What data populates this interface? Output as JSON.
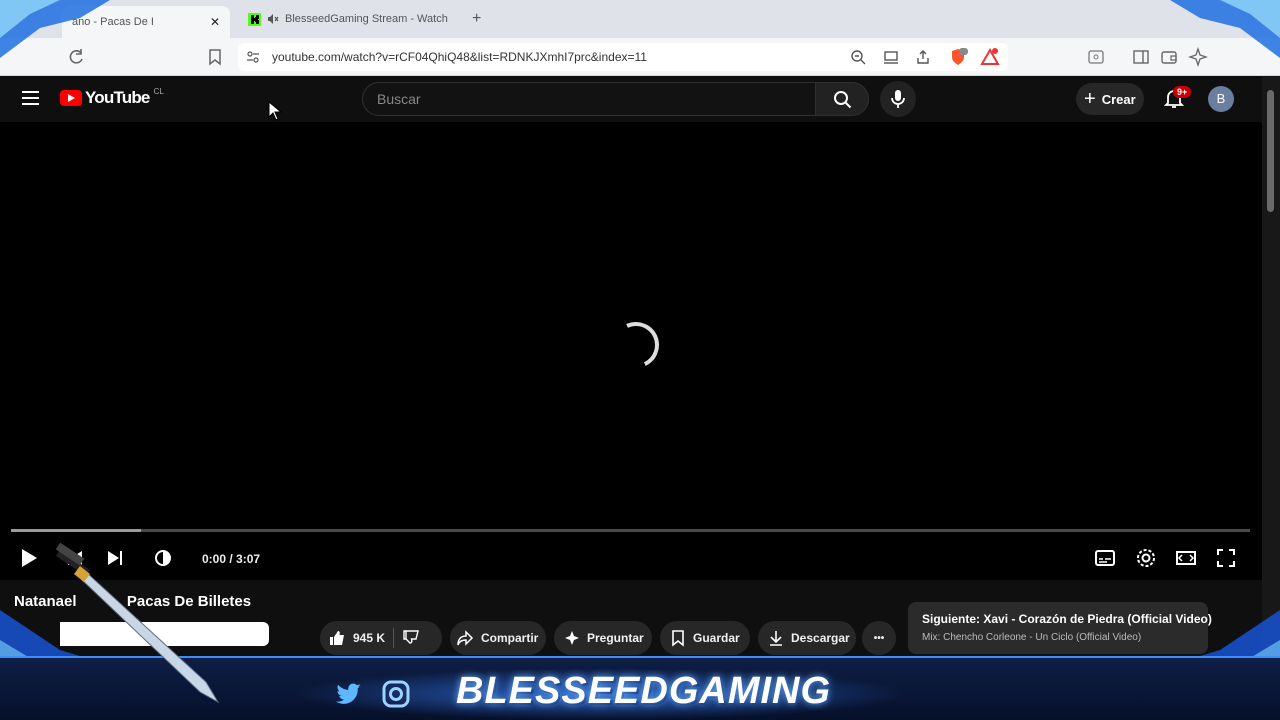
{
  "browser": {
    "tabs": [
      {
        "label": "Natanael Cano - Pacas De Billetes",
        "visible_label": "ano - Pacas De I",
        "active": true
      },
      {
        "label": "BlesseedGaming Stream - Watch",
        "active": false,
        "muted": true
      }
    ],
    "new_tab_label": "+",
    "close_label": "✕",
    "url": "youtube.com/watch?v=rCF04QhiQ48&list=RDNKJXmhI7prc&index=11"
  },
  "youtube": {
    "logo_text": "YouTube",
    "country_code": "CL",
    "search_placeholder": "Buscar",
    "create_label": "Crear",
    "notifications_badge": "9+",
    "avatar_letter": "B",
    "player": {
      "time": "0:00 / 3:07",
      "buffered_fraction": 0.105,
      "played_fraction": 0
    },
    "video_title_left": "Natanael",
    "video_title_right": "Pacas De Billetes",
    "actions": {
      "likes": "945 K",
      "share": "Compartir",
      "ask": "Preguntar",
      "save": "Guardar",
      "download": "Descargar",
      "more": "•••"
    },
    "up_next": {
      "title": "Siguiente: Xavi - Corazón de Piedra (Official Video)",
      "subtitle": "Mix: Chencho Corleone - Un Ciclo  (Official Video)"
    }
  },
  "overlay": {
    "brand": "BLESSEEDGAMING",
    "icons": [
      "twitter-icon",
      "instagram-icon"
    ],
    "accent_color": "#2f7ff0"
  }
}
